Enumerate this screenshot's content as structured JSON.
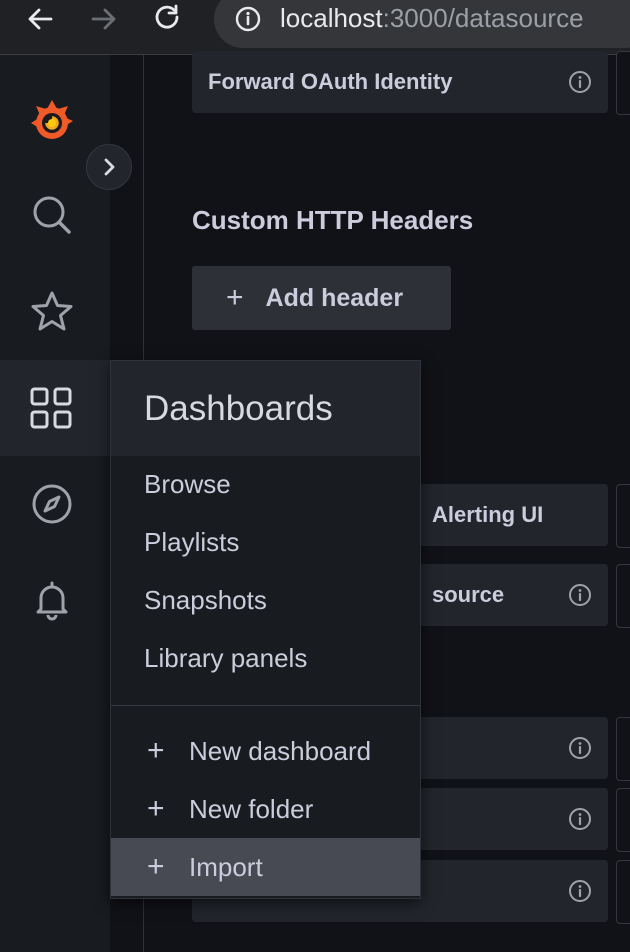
{
  "browser": {
    "url_host": "localhost",
    "url_rest": ":3000/datasource"
  },
  "main": {
    "rows_top": [
      {
        "label": "Forward OAuth Identity",
        "info": true
      }
    ],
    "section_title": "Custom HTTP Headers",
    "add_header_label": "Add header",
    "rows_partial": [
      {
        "label": "Alerting UI",
        "info": false
      },
      {
        "label": "source",
        "info": true
      },
      {
        "label": "",
        "info": true
      },
      {
        "label": "",
        "info": true
      },
      {
        "label": "",
        "info": true
      }
    ]
  },
  "dropdown": {
    "title": "Dashboards",
    "items": [
      "Browse",
      "Playlists",
      "Snapshots",
      "Library panels"
    ],
    "actions": [
      "New dashboard",
      "New folder",
      "Import"
    ]
  },
  "colors": {
    "grafana_orange": "#f05a28",
    "sidebar_bg": "#181b1f",
    "main_bg": "#111217",
    "hover_bg": "#474a53"
  },
  "icons": [
    "back-arrow-icon",
    "forward-arrow-icon",
    "reload-icon",
    "info-icon",
    "grafana-logo-icon",
    "search-icon",
    "star-icon",
    "dashboards-grid-icon",
    "compass-icon",
    "bell-icon",
    "chevron-right-icon",
    "plus-icon"
  ]
}
